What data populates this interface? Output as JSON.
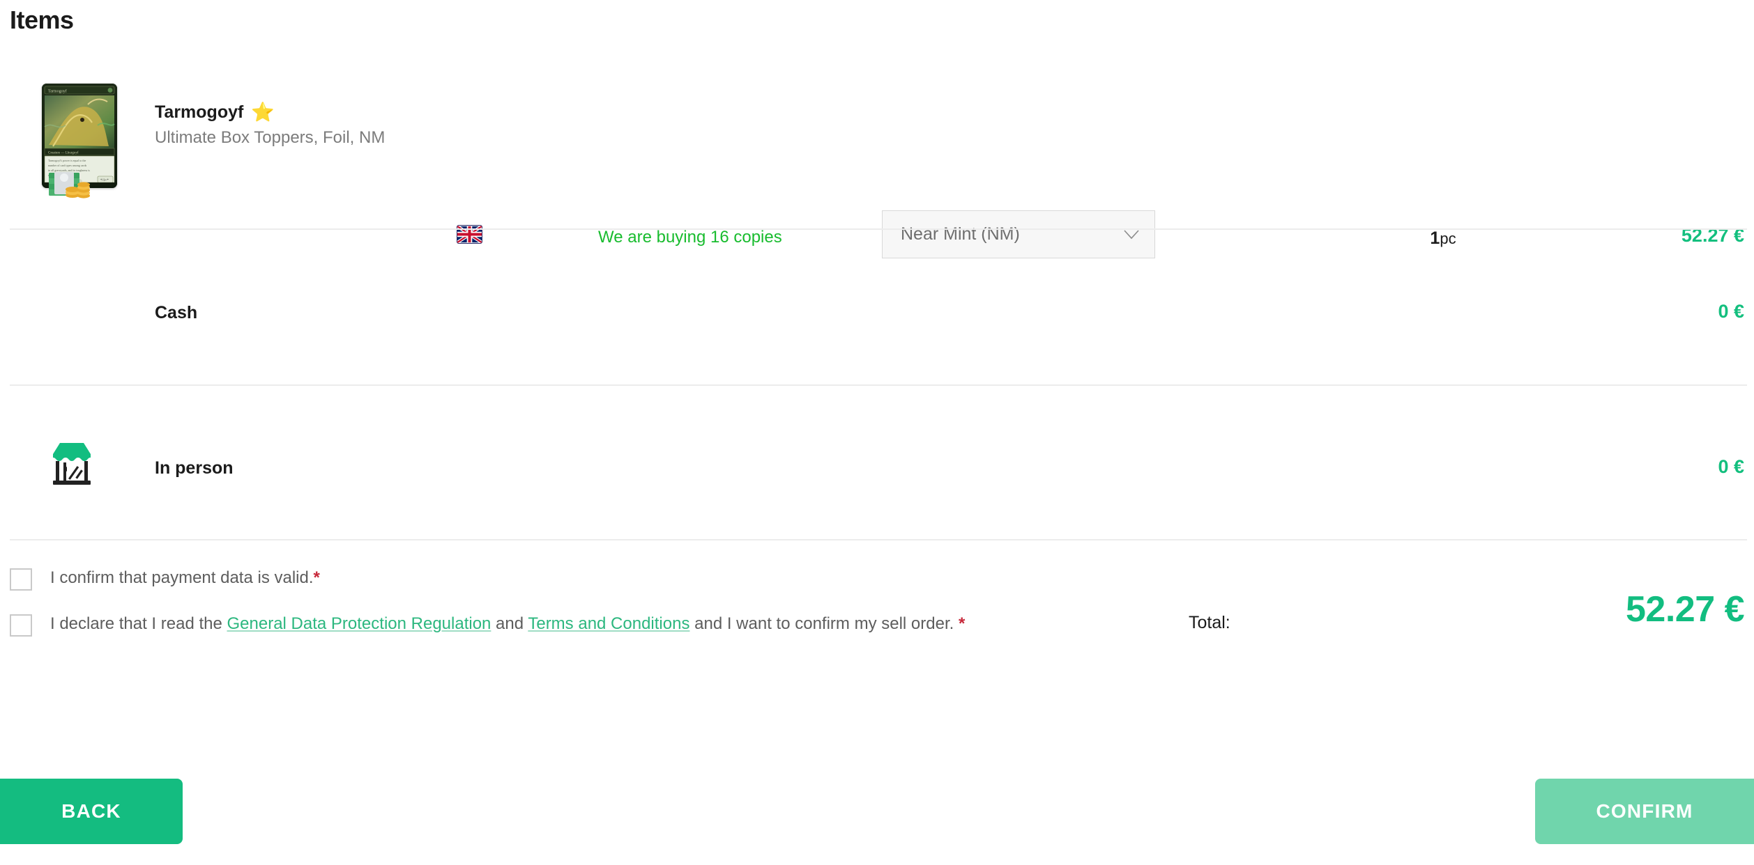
{
  "header": {
    "title": "Items"
  },
  "item": {
    "name": "Tarmogoyf",
    "star_icon": "star-icon",
    "star_glyph": "⭐",
    "subtitle": "Ultimate Box Toppers, Foil, NM",
    "language_flag_icon": "uk-flag-icon",
    "language_flag_glyph": "🇬🇧",
    "buying_note": "We are buying 16 copies",
    "condition": {
      "selected": "Near Mint (NM)",
      "chevron_icon": "chevron-down-icon",
      "options": [
        "Near Mint (NM)"
      ]
    },
    "quantity": "1",
    "quantity_unit": "pc",
    "price": "52.27 €"
  },
  "payment": {
    "icon": "cash-icon",
    "icon_glyph": "💵",
    "label": "Cash",
    "amount": "0 €"
  },
  "delivery": {
    "icon": "storefront-icon",
    "label": "In person",
    "amount": "0 €"
  },
  "confirmations": [
    {
      "id": "payment-data-valid",
      "text_before": "I confirm that payment data is valid.",
      "required_marker": "*",
      "checked": false
    },
    {
      "id": "gdpr-terms",
      "text_start": "I declare that I read the ",
      "link1": "General Data Protection Regulation",
      "text_mid": " and ",
      "link2": "Terms and Conditions",
      "text_end": " and I want to confirm my sell order. ",
      "required_marker": "*",
      "checked": false
    }
  ],
  "total": {
    "label": "Total:",
    "value": "52.27 €"
  },
  "footer": {
    "back_label": "BACK",
    "confirm_label": "CONFIRM"
  },
  "colors": {
    "accent_green": "#14bc80",
    "accent_green_muted": "#70d5ac",
    "price_green": "#13bf7e",
    "buying_note_green": "#18bc2e",
    "link_green": "#2cb77f",
    "required_red": "#c7283a",
    "divider": "#ececec",
    "text_dark": "#1b1b1b",
    "text_muted": "#7c7c7c"
  }
}
